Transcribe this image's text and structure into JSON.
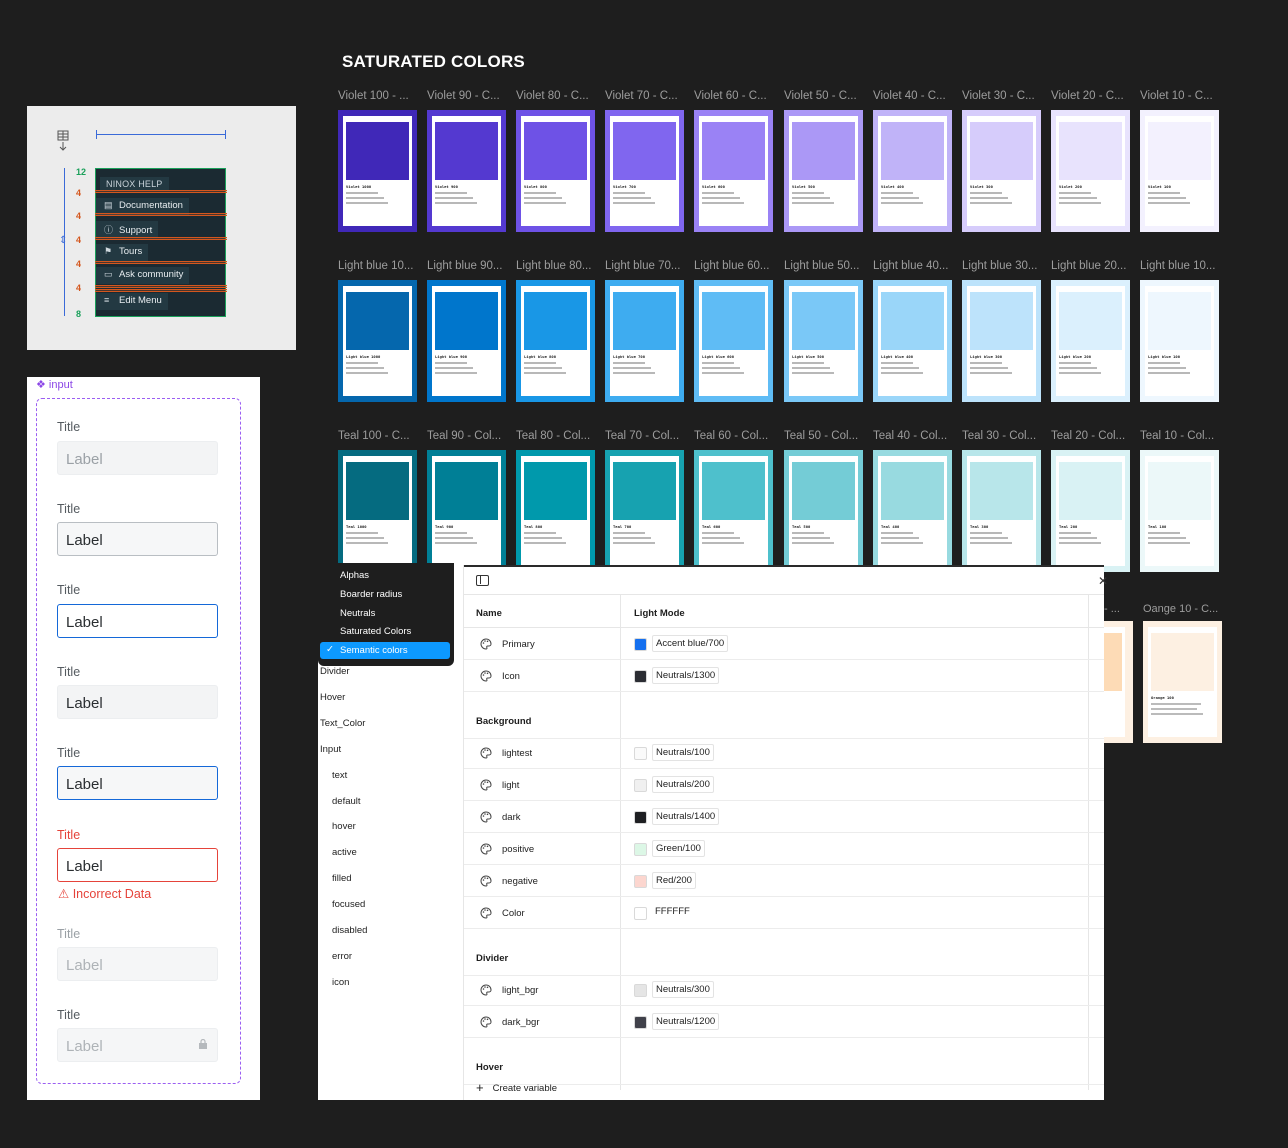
{
  "menu_frame": {
    "header": "NINOX HELP",
    "items": [
      {
        "label": "Documentation",
        "icon": "document-icon"
      },
      {
        "label": "Support",
        "icon": "help-circle-icon"
      },
      {
        "label": "Tours",
        "icon": "flag-icon"
      },
      {
        "label": "Ask community",
        "icon": "chat-icon"
      },
      {
        "label": "Edit Menu",
        "icon": "edit-list-icon"
      }
    ],
    "spacing": [
      "12",
      "4",
      "4",
      "4",
      "4",
      "4",
      "8"
    ]
  },
  "input_frame": {
    "component_name": "input",
    "fields": [
      {
        "state": "default",
        "title": "Title",
        "value": "Label"
      },
      {
        "state": "hover",
        "title": "Title",
        "value": "Label"
      },
      {
        "state": "active",
        "title": "Title",
        "value": "Label"
      },
      {
        "state": "filled",
        "title": "Title",
        "value": "Label"
      },
      {
        "state": "focused",
        "title": "Title",
        "value": "Label"
      },
      {
        "state": "error",
        "title": "Title",
        "value": "Label",
        "error": "Incorrect Data"
      },
      {
        "state": "disabled",
        "title": "Title",
        "value": "Label"
      },
      {
        "state": "icon",
        "title": "Title",
        "value": "Label"
      }
    ]
  },
  "saturated": {
    "title": "SATURATED COLORS",
    "rows": [
      {
        "labels": [
          "Violet 100 - ...",
          "Violet 90 - C...",
          "Violet 80 - C...",
          "Violet 70 - C...",
          "Violet 60 - C...",
          "Violet 50 - C...",
          "Violet 40 - C...",
          "Violet 30 - C...",
          "Violet 20 - C...",
          "Violet 10 - C..."
        ],
        "names": [
          "Violet 1000",
          "Violet 900",
          "Violet 800",
          "Violet 700",
          "Violet 600",
          "Violet 500",
          "Violet 400",
          "Violet 300",
          "Violet 200",
          "Violet 100"
        ],
        "colors": [
          "#4028b8",
          "#5439d0",
          "#6e52e6",
          "#8066ef",
          "#9a82f5",
          "#ab98f6",
          "#c0b3f8",
          "#d6ccfb",
          "#e8e3fd",
          "#f3f1fe"
        ]
      },
      {
        "labels": [
          "Light blue 10...",
          "Light blue 90...",
          "Light blue 80...",
          "Light blue 70...",
          "Light blue 60...",
          "Light blue 50...",
          "Light blue 40...",
          "Light blue 30...",
          "Light blue 20...",
          "Light blue 10..."
        ],
        "names": [
          "Light blue 1000",
          "Light blue 900",
          "Light blue 800",
          "Light blue 700",
          "Light blue 600",
          "Light blue 500",
          "Light blue 400",
          "Light blue 300",
          "Light blue 200",
          "Light blue 100"
        ],
        "colors": [
          "#0567ad",
          "#0076cc",
          "#1997e6",
          "#3eacf0",
          "#5fbcf5",
          "#7ac8f7",
          "#9ad6f9",
          "#bde3fb",
          "#dbf0fd",
          "#eef7fe"
        ]
      },
      {
        "labels": [
          "Teal 100 - C...",
          "Teal 90 - Col...",
          "Teal 80 - Col...",
          "Teal 70 - Col...",
          "Teal 60 - Col...",
          "Teal 50 - Col...",
          "Teal 40 - Col...",
          "Teal 30 - Col...",
          "Teal 20 - Col...",
          "Teal 10 - Col..."
        ],
        "names": [
          "Teal 1000",
          "Teal 900",
          "Teal 800",
          "Teal 700",
          "Teal 600",
          "Teal 500",
          "Teal 400",
          "Teal 300",
          "Teal 200",
          "Teal 100"
        ],
        "colors": [
          "#056b80",
          "#007f96",
          "#0099ac",
          "#17a2b0",
          "#4ec0cc",
          "#74ccd6",
          "#98dae0",
          "#b8e6ea",
          "#d9f2f4",
          "#ecf8f9"
        ]
      }
    ],
    "orange": {
      "label_partial": "- ...",
      "label": "Oange 10 - C...",
      "name": "Orange 100"
    }
  },
  "variables_panel": {
    "collections": [
      {
        "label": "Alphas",
        "selected": false
      },
      {
        "label": "Boarder radius",
        "selected": false
      },
      {
        "label": "Neutrals",
        "selected": false
      },
      {
        "label": "Saturated Colors",
        "selected": false
      },
      {
        "label": "Semantic colors",
        "selected": true
      }
    ],
    "groups": [
      {
        "label": "Divider",
        "indent": false
      },
      {
        "label": "Hover",
        "indent": false
      },
      {
        "label": "Text_Color",
        "indent": false
      },
      {
        "label": "Input",
        "indent": false
      },
      {
        "label": "text",
        "indent": true
      },
      {
        "label": "default",
        "indent": true
      },
      {
        "label": "hover",
        "indent": true
      },
      {
        "label": "active",
        "indent": true
      },
      {
        "label": "filled",
        "indent": true
      },
      {
        "label": "focused",
        "indent": true
      },
      {
        "label": "disabled",
        "indent": true
      },
      {
        "label": "error",
        "indent": true
      },
      {
        "label": "icon",
        "indent": true
      }
    ],
    "columns": {
      "name": "Name",
      "mode": "Light Mode"
    },
    "sections": [
      {
        "title": "",
        "rows": [
          {
            "name": "Primary",
            "value": "Accent blue/700",
            "color": "#1570ef"
          },
          {
            "name": "Icon",
            "value": "Neutrals/1300",
            "color": "#2b2d33"
          }
        ]
      },
      {
        "title": "Background",
        "rows": [
          {
            "name": "lightest",
            "value": "Neutrals/100",
            "color": "#fafafa"
          },
          {
            "name": "light",
            "value": "Neutrals/200",
            "color": "#f0f0f0"
          },
          {
            "name": "dark",
            "value": "Neutrals/1400",
            "color": "#1e1f22"
          },
          {
            "name": "positive",
            "value": "Green/100",
            "color": "#dcf7e6"
          },
          {
            "name": "negative",
            "value": "Red/200",
            "color": "#fcd6cf"
          },
          {
            "name": "Color",
            "value": "FFFFFF",
            "color": "#ffffff",
            "plain": true
          }
        ]
      },
      {
        "title": "Divider",
        "rows": [
          {
            "name": "light_bgr",
            "value": "Neutrals/300",
            "color": "#e5e5e5"
          },
          {
            "name": "dark_bgr",
            "value": "Neutrals/1200",
            "color": "#40414a"
          }
        ]
      },
      {
        "title": "Hover",
        "rows": []
      }
    ],
    "create_label": "Create variable"
  }
}
